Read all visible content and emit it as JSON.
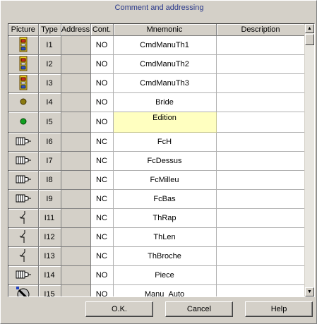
{
  "dialog": {
    "title": "Comment and addressing"
  },
  "columns": {
    "picture": "Picture",
    "type": "Type",
    "address": "Address",
    "cont": "Cont.",
    "mnemonic": "Mnemonic",
    "description": "Description"
  },
  "rows": [
    {
      "icon": "push-button-icon",
      "type": "I1",
      "address": "",
      "cont": "NO",
      "mnemonic": "CmdManuTh1",
      "description": ""
    },
    {
      "icon": "push-button-icon",
      "type": "I2",
      "address": "",
      "cont": "NO",
      "mnemonic": "CmdManuTh2",
      "description": ""
    },
    {
      "icon": "push-button-icon",
      "type": "I3",
      "address": "",
      "cont": "NO",
      "mnemonic": "CmdManuTh3",
      "description": ""
    },
    {
      "icon": "olive-sensor-icon",
      "type": "I4",
      "address": "",
      "cont": "NO",
      "mnemonic": "Bride",
      "description": ""
    },
    {
      "icon": "green-sensor-icon",
      "type": "I5",
      "address": "",
      "cont": "NO",
      "mnemonic": "Edition",
      "description": ""
    },
    {
      "icon": "proximity-sensor-icon",
      "type": "I6",
      "address": "",
      "cont": "NC",
      "mnemonic": "FcH",
      "description": ""
    },
    {
      "icon": "proximity-sensor-icon",
      "type": "I7",
      "address": "",
      "cont": "NC",
      "mnemonic": "FcDessus",
      "description": ""
    },
    {
      "icon": "proximity-sensor-icon",
      "type": "I8",
      "address": "",
      "cont": "NC",
      "mnemonic": "FcMilleu",
      "description": ""
    },
    {
      "icon": "proximity-sensor-icon",
      "type": "I9",
      "address": "",
      "cont": "NC",
      "mnemonic": "FcBas",
      "description": ""
    },
    {
      "icon": "switch-contact-icon",
      "type": "I11",
      "address": "",
      "cont": "NC",
      "mnemonic": "ThRap",
      "description": ""
    },
    {
      "icon": "switch-contact-icon",
      "type": "I12",
      "address": "",
      "cont": "NC",
      "mnemonic": "ThLen",
      "description": ""
    },
    {
      "icon": "switch-contact-icon",
      "type": "I13",
      "address": "",
      "cont": "NC",
      "mnemonic": "ThBroche",
      "description": ""
    },
    {
      "icon": "proximity-sensor-icon",
      "type": "I14",
      "address": "",
      "cont": "NO",
      "mnemonic": "Piece",
      "description": ""
    },
    {
      "icon": "selector-switch-icon",
      "type": "I15",
      "address": "",
      "cont": "NO",
      "mnemonic": "Manu_Auto",
      "description": ""
    }
  ],
  "selected_row_mnemonic": "Edition",
  "buttons": {
    "ok": "O.K.",
    "cancel": "Cancel",
    "help": "Help"
  },
  "colors": {
    "title_text": "#2b3a8c",
    "selected_cell": "#ffffc0",
    "dialog_bg": "#d4d0c8"
  }
}
